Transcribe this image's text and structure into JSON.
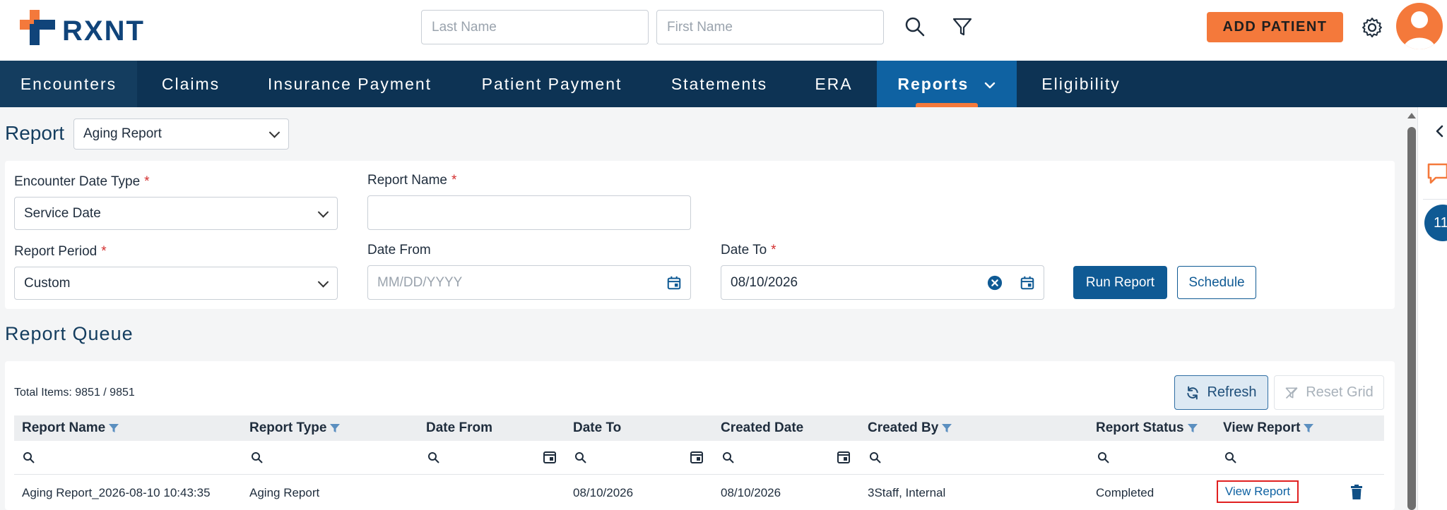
{
  "header": {
    "logo_text": "RXNT",
    "last_name_placeholder": "Last Name",
    "first_name_placeholder": "First Name",
    "add_patient_label": "ADD PATIENT",
    "brand_color": "#0d3354",
    "accent_color": "#f4793b"
  },
  "nav": {
    "items": [
      {
        "label": "Encounters"
      },
      {
        "label": "Claims"
      },
      {
        "label": "Insurance Payment"
      },
      {
        "label": "Patient Payment"
      },
      {
        "label": "Statements"
      },
      {
        "label": "ERA"
      },
      {
        "label": "Reports",
        "active": true
      },
      {
        "label": "Eligibility"
      }
    ]
  },
  "report": {
    "label": "Report",
    "selected": "Aging Report"
  },
  "filters": {
    "encounter_date_type_label": "Encounter Date Type",
    "encounter_date_type_value": "Service Date",
    "report_name_label": "Report Name",
    "report_name_value": "",
    "report_period_label": "Report Period",
    "report_period_value": "Custom",
    "date_from_label": "Date From",
    "date_from_placeholder": "MM/DD/YYYY",
    "date_to_label": "Date To",
    "date_to_value": "08/10/2026",
    "required_mark": "*",
    "run_report_label": "Run Report",
    "schedule_label": "Schedule"
  },
  "queue": {
    "title": "Report Queue",
    "total_items": "Total Items: 9851 / 9851",
    "refresh_label": "Refresh",
    "reset_grid_label": "Reset Grid",
    "columns": {
      "report_name": "Report Name",
      "report_type": "Report Type",
      "date_from": "Date From",
      "date_to": "Date To",
      "created_date": "Created Date",
      "created_by": "Created By",
      "report_status": "Report Status",
      "view_report": "View Report"
    },
    "rows": [
      {
        "report_name": "Aging Report_2026-08-10 10:43:35",
        "report_type": "Aging Report",
        "date_from": "",
        "date_to": "08/10/2026",
        "created_date": "08/10/2026",
        "created_by": "3Staff, Internal",
        "report_status": "Completed",
        "view_report": "View Report"
      }
    ]
  },
  "side": {
    "badge": "11"
  }
}
